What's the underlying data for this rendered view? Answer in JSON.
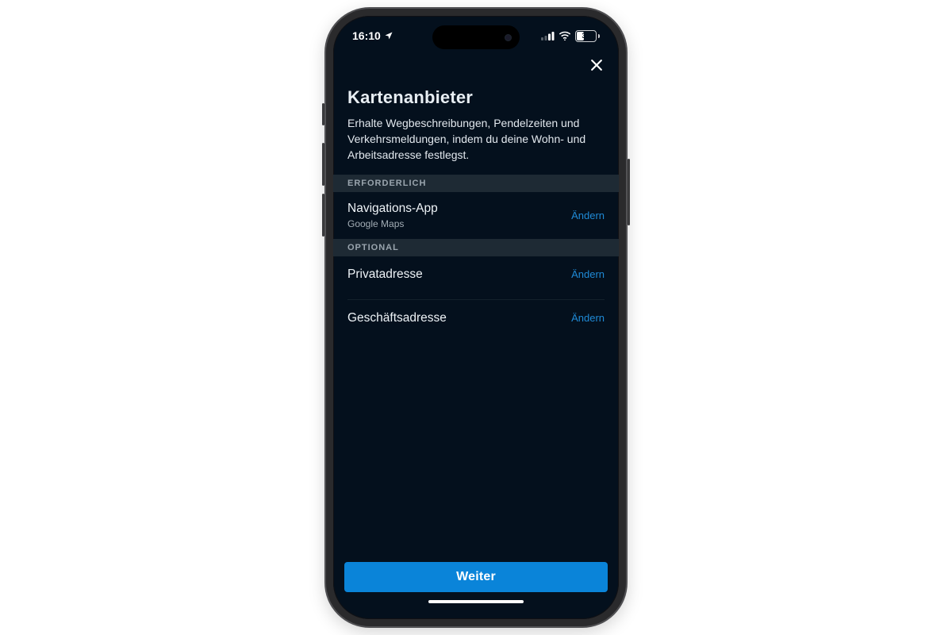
{
  "statusbar": {
    "time": "16:10",
    "battery_percent": "36"
  },
  "page": {
    "title": "Kartenanbieter",
    "subtitle": "Erhalte Wegbeschreibungen, Pendelzeiten und Verkehrsmeldungen, indem du deine Wohn- und Arbeitsadresse festlegst."
  },
  "sections": {
    "required": {
      "header": "ERFORDERLICH",
      "nav_app": {
        "label": "Navigations-App",
        "value": "Google Maps",
        "action": "Ändern"
      }
    },
    "optional": {
      "header": "OPTIONAL",
      "home": {
        "label": "Privatadresse",
        "action": "Ändern"
      },
      "work": {
        "label": "Geschäftsadresse",
        "action": "Ändern"
      }
    }
  },
  "cta": {
    "continue": "Weiter"
  }
}
